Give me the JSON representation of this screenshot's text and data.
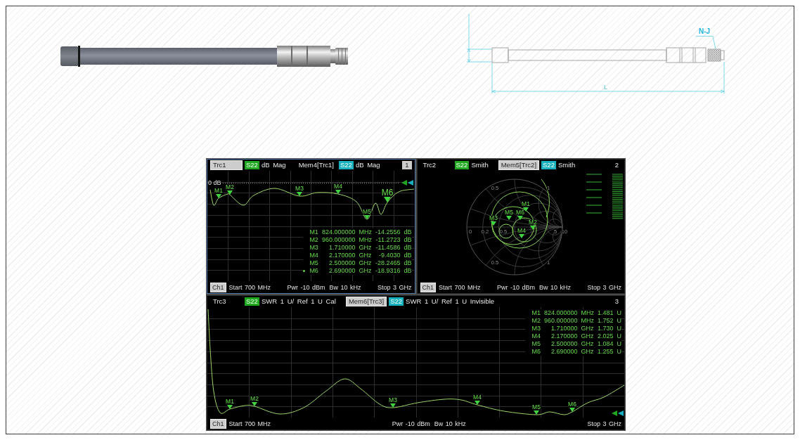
{
  "drawing": {
    "connector_label": "N-J",
    "length_label": "L"
  },
  "analyzer": {
    "windows": [
      {
        "kind": "dbmag",
        "number": "1",
        "active": true,
        "traces": [
          {
            "label": "Trc1",
            "parameter": "S22",
            "format": "dB Mag",
            "color": "#1fa81f",
            "selected": true
          },
          {
            "label": "Mem4[Trc1]",
            "parameter": "S22",
            "format": "dB Mag",
            "color": "#17b0bf",
            "selected": false
          }
        ],
        "reference_label": "0 dB",
        "plot_markers": [
          {
            "label": "M1",
            "active": false
          },
          {
            "label": "M2",
            "active": false
          },
          {
            "label": "M3",
            "active": false
          },
          {
            "label": "M4",
            "active": false
          },
          {
            "label": "M5",
            "active": false
          },
          {
            "label": "M6",
            "active": true
          }
        ],
        "marker_table": [
          {
            "name": "M1",
            "stimulus": "824.000000",
            "stimulus_unit": "MHz",
            "response": "-14.2556",
            "response_unit": "dB",
            "active": false
          },
          {
            "name": "M2",
            "stimulus": "960.000000",
            "stimulus_unit": "MHz",
            "response": "-11.2723",
            "response_unit": "dB",
            "active": false
          },
          {
            "name": "M3",
            "stimulus": "1.710000",
            "stimulus_unit": "GHz",
            "response": "-11.4586",
            "response_unit": "dB",
            "active": false
          },
          {
            "name": "M4",
            "stimulus": "2.170000",
            "stimulus_unit": "GHz",
            "response": "-9.4030",
            "response_unit": "dB",
            "active": false
          },
          {
            "name": "M5",
            "stimulus": "2.500000",
            "stimulus_unit": "GHz",
            "response": "-28.2465",
            "response_unit": "dB",
            "active": false
          },
          {
            "name": "M6",
            "stimulus": "2.690000",
            "stimulus_unit": "GHz",
            "response": "-18.9316",
            "response_unit": "dB",
            "active": true
          }
        ],
        "footer": {
          "channel": "Ch1",
          "start": "Start 700 MHz",
          "power": "Pwr -10 dBm",
          "bandwidth": "Bw 10 kHz",
          "stop": "Stop 3 GHz"
        }
      },
      {
        "kind": "smith",
        "number": "2",
        "active": false,
        "traces": [
          {
            "label": "Trc2",
            "parameter": "S22",
            "format": "Smith",
            "color": "#1fa81f",
            "selected": false
          },
          {
            "label": "Mem5[Trc2]",
            "parameter": "S22",
            "format": "Smith",
            "color": "#17b0bf",
            "selected": true
          }
        ],
        "grid_labels": [
          "0.5",
          "1",
          "0",
          "0.2",
          "0.5",
          "5",
          "10",
          "0.5",
          "1"
        ],
        "plot_markers": [
          {
            "label": "M1",
            "active": false
          },
          {
            "label": "M2",
            "active": false
          },
          {
            "label": "M3",
            "active": false
          },
          {
            "label": "M4",
            "active": false
          },
          {
            "label": "M5",
            "active": false
          },
          {
            "label": "M6",
            "active": false
          }
        ],
        "footer": {
          "channel": "Ch1",
          "start": "Start 700 MHz",
          "power": "Pwr -10 dBm",
          "bandwidth": "Bw 10 kHz",
          "stop": "Stop 3 GHz"
        }
      },
      {
        "kind": "swr",
        "number": "3",
        "active": false,
        "traces": [
          {
            "label": "Trc3",
            "parameter": "S22",
            "format": "SWR 1 U/ Ref 1 U Cal",
            "color": "#1fa81f",
            "selected": false
          },
          {
            "label": "Mem6[Trc3]",
            "parameter": "S22",
            "format": "SWR 1 U/ Ref 1 U Invisible",
            "color": "#17b0bf",
            "selected": true
          }
        ],
        "plot_markers": [
          {
            "label": "M1",
            "active": false
          },
          {
            "label": "M2",
            "active": false
          },
          {
            "label": "M3",
            "active": false
          },
          {
            "label": "M4",
            "active": false
          },
          {
            "label": "M5",
            "active": false
          },
          {
            "label": "M6",
            "active": false
          }
        ],
        "marker_table": [
          {
            "name": "M1",
            "stimulus": "824.000000",
            "stimulus_unit": "MHz",
            "response": "1.481",
            "response_unit": "U"
          },
          {
            "name": "M2",
            "stimulus": "960.000000",
            "stimulus_unit": "MHz",
            "response": "1.752",
            "response_unit": "U"
          },
          {
            "name": "M3",
            "stimulus": "1.710000",
            "stimulus_unit": "GHz",
            "response": "1.730",
            "response_unit": "U"
          },
          {
            "name": "M4",
            "stimulus": "2.170000",
            "stimulus_unit": "GHz",
            "response": "2.025",
            "response_unit": "U"
          },
          {
            "name": "M5",
            "stimulus": "2.500000",
            "stimulus_unit": "GHz",
            "response": "1.084",
            "response_unit": "U"
          },
          {
            "name": "M6",
            "stimulus": "2.690000",
            "stimulus_unit": "GHz",
            "response": "1.255",
            "response_unit": "U"
          }
        ],
        "footer": {
          "channel": "Ch1",
          "start": "Start 700 MHz",
          "power": "Pwr -10 dBm",
          "bandwidth": "Bw 10 kHz",
          "stop": "Stop 3 GHz"
        }
      }
    ]
  }
}
